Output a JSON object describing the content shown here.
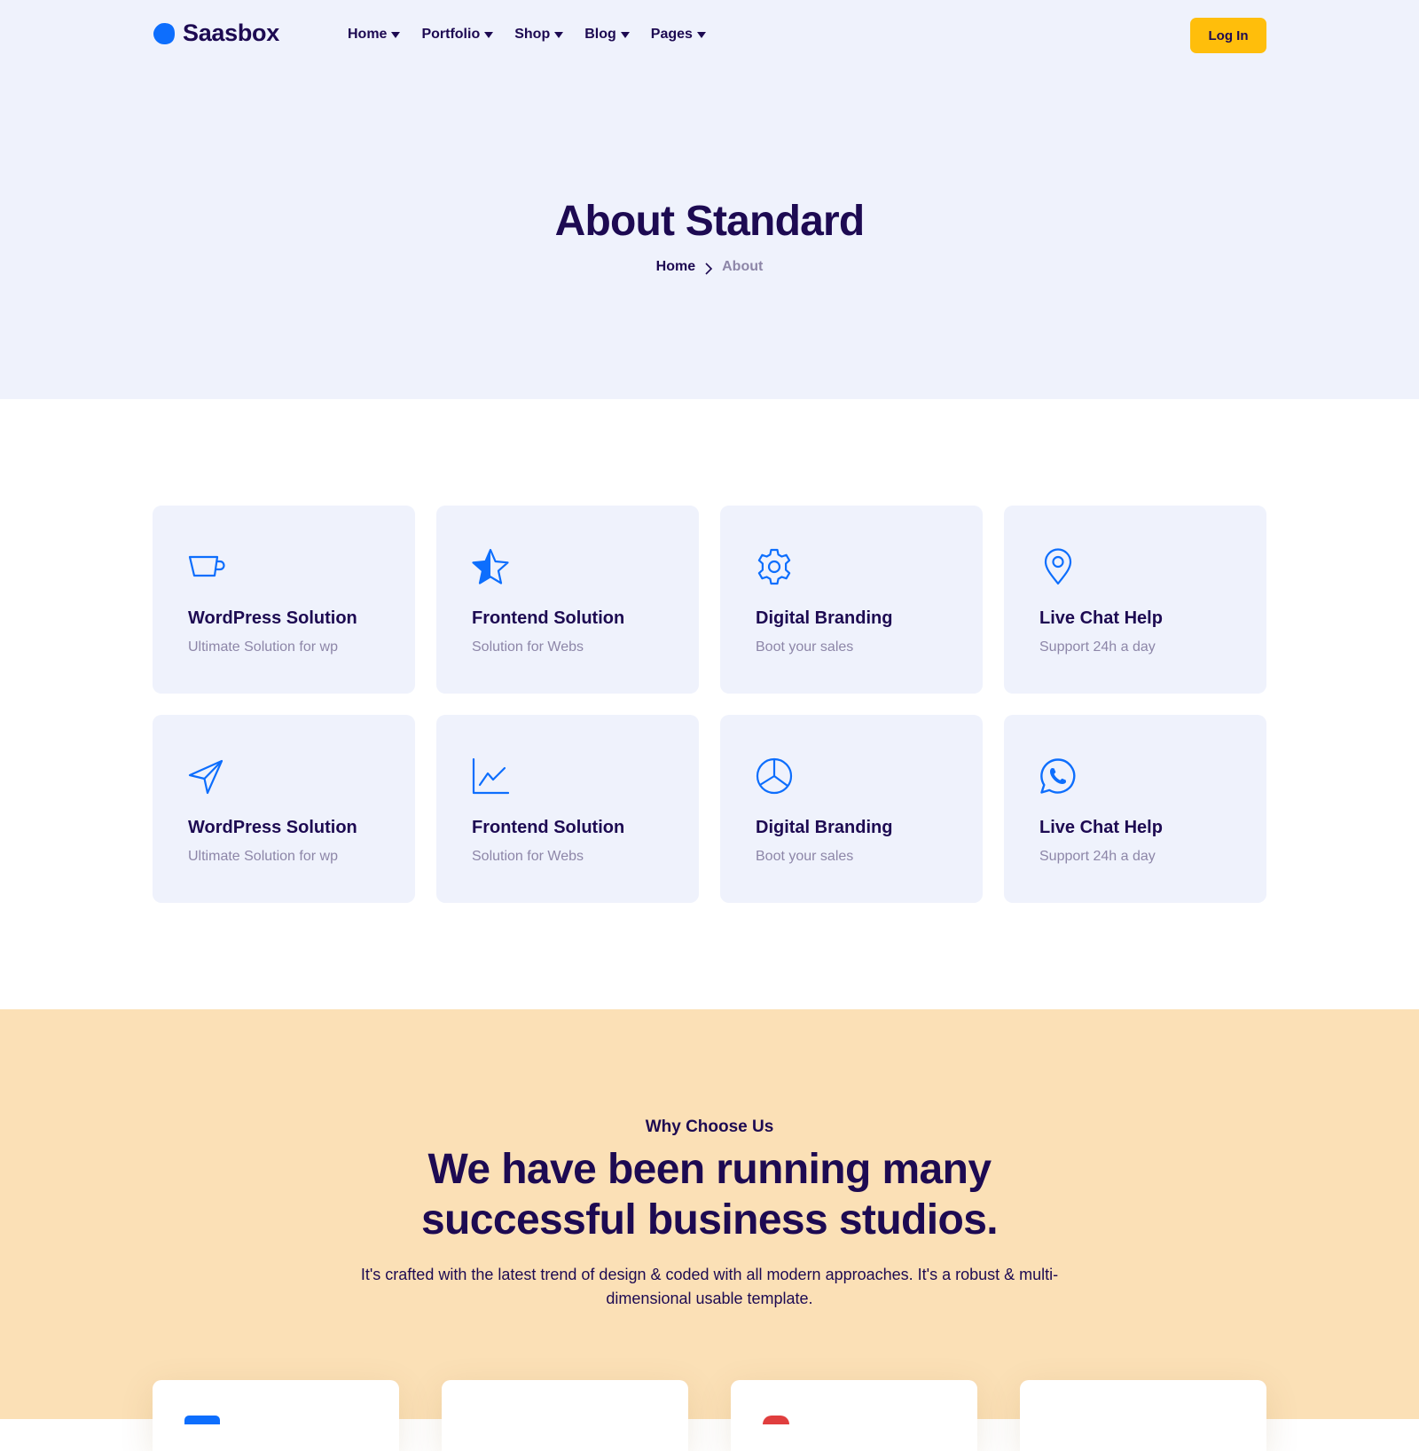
{
  "colors": {
    "brand_blue": "#0d6efd",
    "navy": "#1d0a52",
    "muted": "#8d86a8",
    "hero_bg": "#eff2fc",
    "accent_yellow": "#ffbe0b",
    "why_bg": "#fbe0b6",
    "red": "#e03e3e"
  },
  "header": {
    "logo_text": "Saasbox",
    "nav": [
      {
        "label": "Home"
      },
      {
        "label": "Portfolio"
      },
      {
        "label": "Shop"
      },
      {
        "label": "Blog"
      },
      {
        "label": "Pages"
      }
    ],
    "login_label": "Log In"
  },
  "hero": {
    "title": "About Standard",
    "breadcrumb": {
      "home": "Home",
      "current": "About"
    }
  },
  "features": [
    {
      "icon": "cup-icon",
      "title": "WordPress Solution",
      "subtitle": "Ultimate Solution for wp"
    },
    {
      "icon": "star-icon",
      "title": "Frontend Solution",
      "subtitle": "Solution for Webs"
    },
    {
      "icon": "gear-icon",
      "title": "Digital Branding",
      "subtitle": "Boot your sales"
    },
    {
      "icon": "map-pin-icon",
      "title": "Live Chat Help",
      "subtitle": "Support 24h a day"
    },
    {
      "icon": "send-icon",
      "title": "WordPress Solution",
      "subtitle": "Ultimate Solution for wp"
    },
    {
      "icon": "line-chart-icon",
      "title": "Frontend Solution",
      "subtitle": "Solution for Webs"
    },
    {
      "icon": "pie-chart-icon",
      "title": "Digital Branding",
      "subtitle": "Boot your sales"
    },
    {
      "icon": "whatsapp-icon",
      "title": "Live Chat Help",
      "subtitle": "Support 24h a day"
    }
  ],
  "why": {
    "eyebrow": "Why Choose Us",
    "heading": "We have been running many successful business studios.",
    "text": "It's crafted with the latest trend of design & coded with all modern approaches. It's a robust & multi-dimensional usable template."
  }
}
